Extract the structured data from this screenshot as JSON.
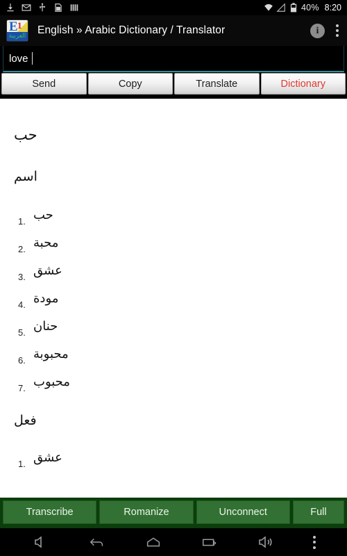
{
  "statusbar": {
    "icons": [
      "download-icon",
      "email-icon",
      "usb-icon",
      "sdcard-icon",
      "signal-bars-icon"
    ],
    "wifi_icon": "wifi-icon",
    "signal_icon": "cell-signal-icon",
    "battery_icon": "battery-icon",
    "battery_text": "40%",
    "time": "8:20"
  },
  "titlebar": {
    "app_icon": "app-logo-icon",
    "app_icon_letter": "E",
    "app_icon_number": "1",
    "app_icon_arabic": "العربية",
    "title": "English » Arabic Dictionary / Translator",
    "info_icon": "info-icon",
    "info_glyph": "i",
    "overflow_icon": "overflow-menu-icon"
  },
  "search": {
    "value": "love",
    "placeholder": "",
    "focused": true,
    "accent_color": "#2f8f9e"
  },
  "action_buttons": [
    {
      "label": "Send",
      "name": "send-button",
      "accent": false
    },
    {
      "label": "Copy",
      "name": "copy-button",
      "accent": false
    },
    {
      "label": "Translate",
      "name": "translate-button",
      "accent": false
    },
    {
      "label": "Dictionary",
      "name": "dictionary-button",
      "accent": true
    }
  ],
  "accent_red": "#e0392f",
  "entry": {
    "headword": "حب",
    "sections": [
      {
        "pos": "اسم",
        "senses": [
          {
            "num": "1.",
            "text": "حب"
          },
          {
            "num": "2.",
            "text": "محبة"
          },
          {
            "num": "3.",
            "text": "عشق"
          },
          {
            "num": "4.",
            "text": "مودة"
          },
          {
            "num": "5.",
            "text": "حنان"
          },
          {
            "num": "6.",
            "text": "محبوبة"
          },
          {
            "num": "7.",
            "text": "محبوب"
          }
        ]
      },
      {
        "pos": "فعل",
        "senses": [
          {
            "num": "1.",
            "text": "عشق"
          }
        ]
      }
    ]
  },
  "bottom_buttons": [
    {
      "label": "Transcribe",
      "name": "transcribe-button"
    },
    {
      "label": "Romanize",
      "name": "romanize-button"
    },
    {
      "label": "Unconnect",
      "name": "unconnect-button"
    },
    {
      "label": "Full",
      "name": "full-button"
    }
  ],
  "bottom_bar_color": "#337033",
  "navbar": {
    "items": [
      "volume-down-icon",
      "back-icon",
      "home-icon",
      "recents-icon",
      "volume-up-icon",
      "menu-icon"
    ]
  }
}
